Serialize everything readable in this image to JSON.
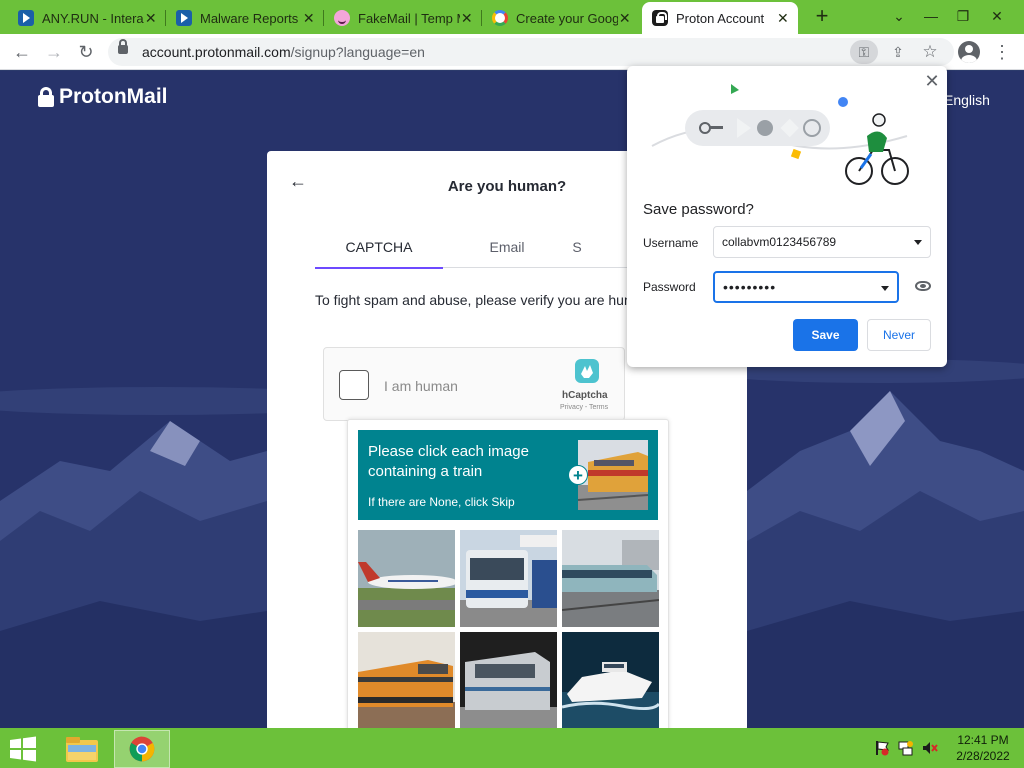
{
  "browser": {
    "tabs": [
      {
        "title": "ANY.RUN - Intera",
        "favicon": "anyrun-icon"
      },
      {
        "title": "Malware Reports",
        "favicon": "anyrun-icon"
      },
      {
        "title": "FakeMail | Temp M",
        "favicon": "fakemail-icon"
      },
      {
        "title": "Create your Goog",
        "favicon": "google-icon"
      },
      {
        "title": "Proton Account",
        "favicon": "proton-lock-icon",
        "active": true
      }
    ],
    "close_glyph": "✕",
    "new_tab_glyph": "+",
    "window_controls": {
      "dropdown": "⌄",
      "minimize": "—",
      "restore": "❐",
      "close": "✕"
    },
    "toolbar": {
      "back_glyph": "←",
      "forward_glyph": "→",
      "reload_glyph": "↻",
      "url_host": "account.protonmail.com",
      "url_path": "/signup?language=en",
      "key_glyph": "⚿",
      "share_glyph": "⇪",
      "star_glyph": "☆",
      "menu_glyph": "⋮"
    }
  },
  "page": {
    "brand": "ProtonMail",
    "language": "English",
    "card": {
      "back_glyph": "←",
      "title": "Are you human?",
      "tabs": [
        "CAPTCHA",
        "Email",
        "S"
      ],
      "active_tab": 0,
      "verify_text": "To fight spam and abuse, please verify you are hum"
    },
    "hcaptcha": {
      "checkbox_label": "I am human",
      "brand": "hCaptcha",
      "terms": "Privacy - Terms"
    },
    "challenge": {
      "prompt": "Please click each image containing a train",
      "sub": "If there are None, click Skip",
      "plus_glyph": "+",
      "images": [
        "airplane",
        "bus",
        "train-platform",
        "train-orange",
        "train-silver",
        "boat"
      ]
    }
  },
  "password_bubble": {
    "close_glyph": "✕",
    "title": "Save password?",
    "username_label": "Username",
    "username_value": "collabvm0123456789",
    "password_label": "Password",
    "password_value": "•••••••••",
    "save_label": "Save",
    "never_label": "Never"
  },
  "taskbar": {
    "time": "12:41 PM",
    "date": "2/28/2022",
    "pinned": [
      "file-explorer-icon",
      "chrome-icon"
    ]
  },
  "colors": {
    "chrome_frame": "#6cc13a",
    "page_bg": "#27336a",
    "proton_accent": "#6d4aff",
    "hcaptcha_teal": "#00838f",
    "chrome_blue": "#1a73e8"
  }
}
